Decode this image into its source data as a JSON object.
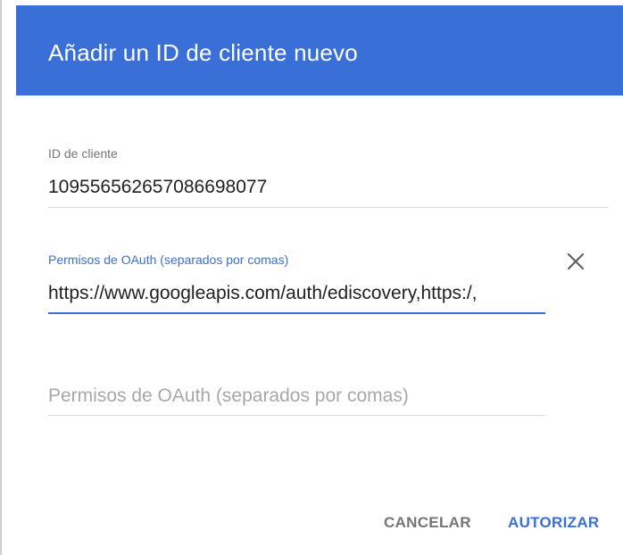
{
  "dialog": {
    "title": "Añadir un ID de cliente nuevo"
  },
  "client_id": {
    "label": "ID de cliente",
    "value": "109556562657086698077"
  },
  "oauth_scope_1": {
    "label": "Permisos de OAuth (separados por comas)",
    "value": "https://www.googleapis.com/auth/ediscovery,https:/,"
  },
  "oauth_scope_2": {
    "placeholder": "Permisos de OAuth (separados por comas)"
  },
  "actions": {
    "cancel_label": "CANCELAR",
    "authorize_label": "AUTORIZAR"
  },
  "icons": {
    "remove": "close-icon"
  },
  "colors": {
    "accent": "#3b6fd8",
    "header_text": "#ffffff",
    "secondary_text": "#757575",
    "placeholder_text": "#a8a8a8"
  }
}
